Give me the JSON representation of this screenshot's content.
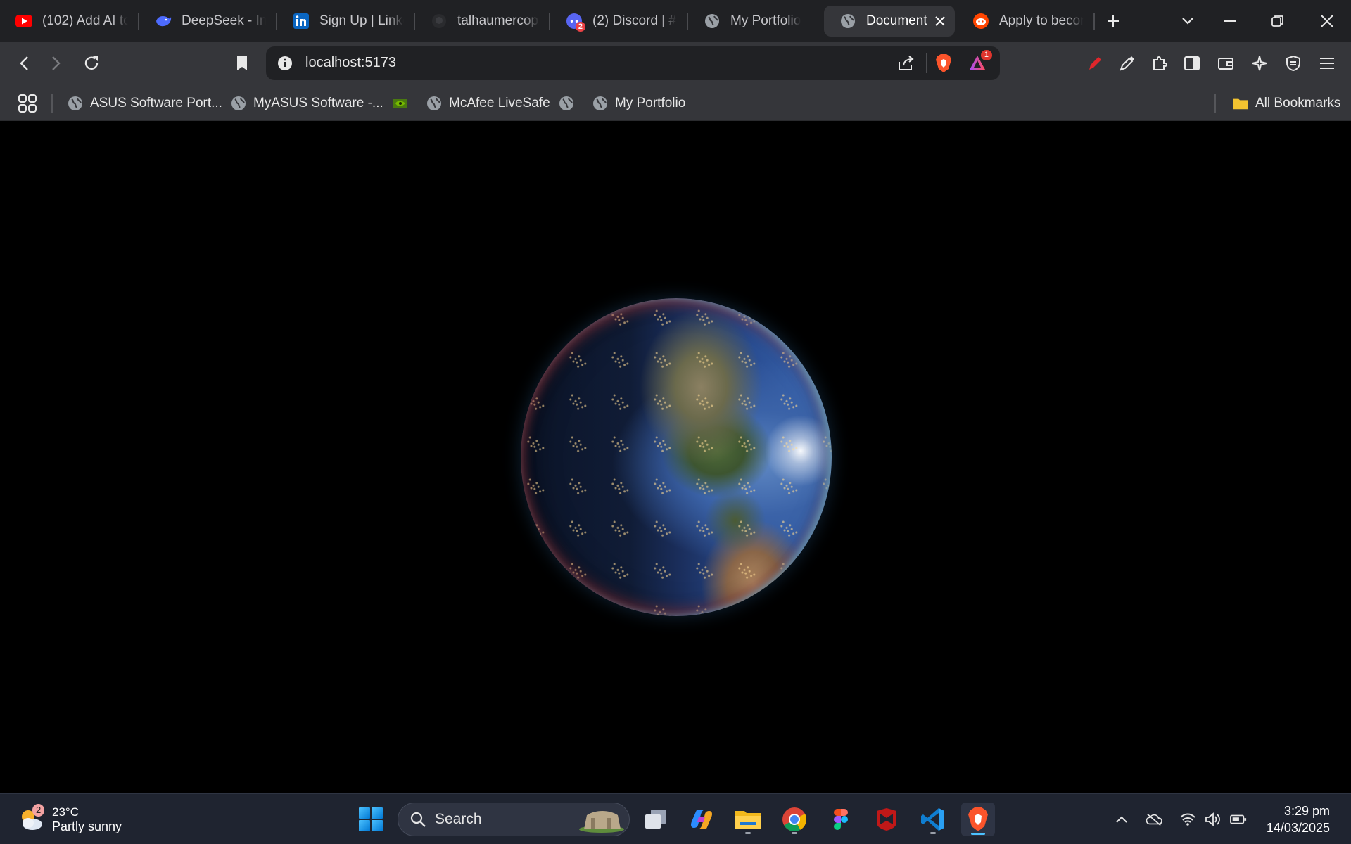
{
  "tabs": [
    {
      "title": "(102) Add AI to",
      "icon": "youtube-icon"
    },
    {
      "title": "DeepSeek - Into",
      "icon": "deepseek-icon"
    },
    {
      "title": "Sign Up | Linked",
      "icon": "linkedin-icon"
    },
    {
      "title": "talhaumercop/",
      "icon": "github-icon"
    },
    {
      "title": "(2) Discord | #g",
      "icon": "discord-icon",
      "badge": "2"
    },
    {
      "title": "My Portfolio",
      "icon": "globe-icon"
    },
    {
      "title": "Document",
      "icon": "globe-icon",
      "active": true
    },
    {
      "title": "Apply to becom",
      "icon": "reddit-icon"
    }
  ],
  "toolbar": {
    "url": "localhost:5173",
    "brave_rewards_badge": "1"
  },
  "bookmarks": {
    "items": [
      "ASUS Software Port...",
      "MyASUS Software -...",
      "McAfee LiveSafe",
      "My Portfolio"
    ],
    "all_bookmarks": "All Bookmarks"
  },
  "taskbar": {
    "weather_temp": "23°C",
    "weather_desc": "Partly sunny",
    "weather_badge": "2",
    "search_label": "Search",
    "time": "3:29 pm",
    "date": "14/03/2025"
  },
  "colors": {
    "tab_bar": "#202124",
    "toolbar": "#35363a",
    "content_bg": "#000000",
    "taskbar": "#1f2430",
    "accent_brave": "#fb542b"
  }
}
